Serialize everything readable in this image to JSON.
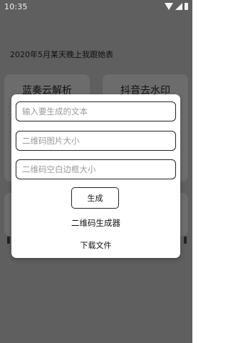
{
  "status_bar": {
    "time": "10:35"
  },
  "background": {
    "love_text": "2020年5月某天晚上我跟她表",
    "cards": [
      {
        "label": "蓝奏云解析"
      },
      {
        "label": "抖音去水印"
      }
    ]
  },
  "dialog": {
    "text_input": {
      "placeholder": "输入要生成的文本",
      "value": ""
    },
    "size_input": {
      "placeholder": "二维码图片大小",
      "value": ""
    },
    "margin_input": {
      "placeholder": "二维码空白边框大小",
      "value": ""
    },
    "generate_label": "生成",
    "title": "二维码生成器",
    "download_label": "下载文件"
  },
  "colors": {
    "overlay": "#5f5f5f",
    "card": "#6c6c6c",
    "dialog_bg": "#ffffff",
    "border": "#222222"
  },
  "icons": [
    "wifi-icon",
    "signal-icon",
    "battery-icon"
  ]
}
